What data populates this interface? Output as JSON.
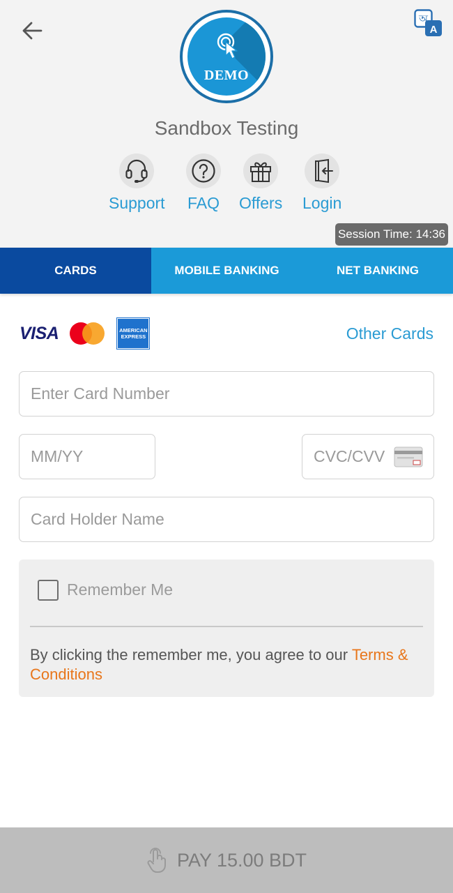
{
  "header": {
    "merchant_name": "Sandbox Testing",
    "logo_text": "DEMO",
    "session_label": "Session Time: 14:36"
  },
  "quick_links": {
    "support": "Support",
    "faq": "FAQ",
    "offers": "Offers",
    "login": "Login"
  },
  "tabs": {
    "cards": "CARDS",
    "mobile_banking": "MOBILE BANKING",
    "net_banking": "NET BANKING",
    "active": "CARDS"
  },
  "card_brands": {
    "visa": "VISA",
    "amex_line1": "AMERICAN",
    "amex_line2": "EXPRESS",
    "other_cards": "Other Cards"
  },
  "form": {
    "card_number_placeholder": "Enter Card Number",
    "expiry_placeholder": "MM/YY",
    "cvc_placeholder": "CVC/CVV",
    "holder_placeholder": "Card Holder Name"
  },
  "remember": {
    "label": "Remember Me",
    "checked": false,
    "terms_prefix": "By clicking the remember me, you agree to our ",
    "terms_link": "Terms & Conditions"
  },
  "pay": {
    "label": "PAY 15.00 BDT"
  },
  "colors": {
    "accent": "#2a9bd3",
    "tab_active": "#0a4a9f",
    "tab_inactive": "#1b9ad8",
    "terms_link": "#e8761b",
    "pay_bar": "#bdbdbd"
  },
  "icons": {
    "back": "arrow-left-icon",
    "language": "translate-icon",
    "support": "headset-icon",
    "faq": "question-circle-icon",
    "offers": "gift-icon",
    "login": "door-enter-icon",
    "cvc": "card-back-icon",
    "pay": "tap-hand-icon"
  }
}
